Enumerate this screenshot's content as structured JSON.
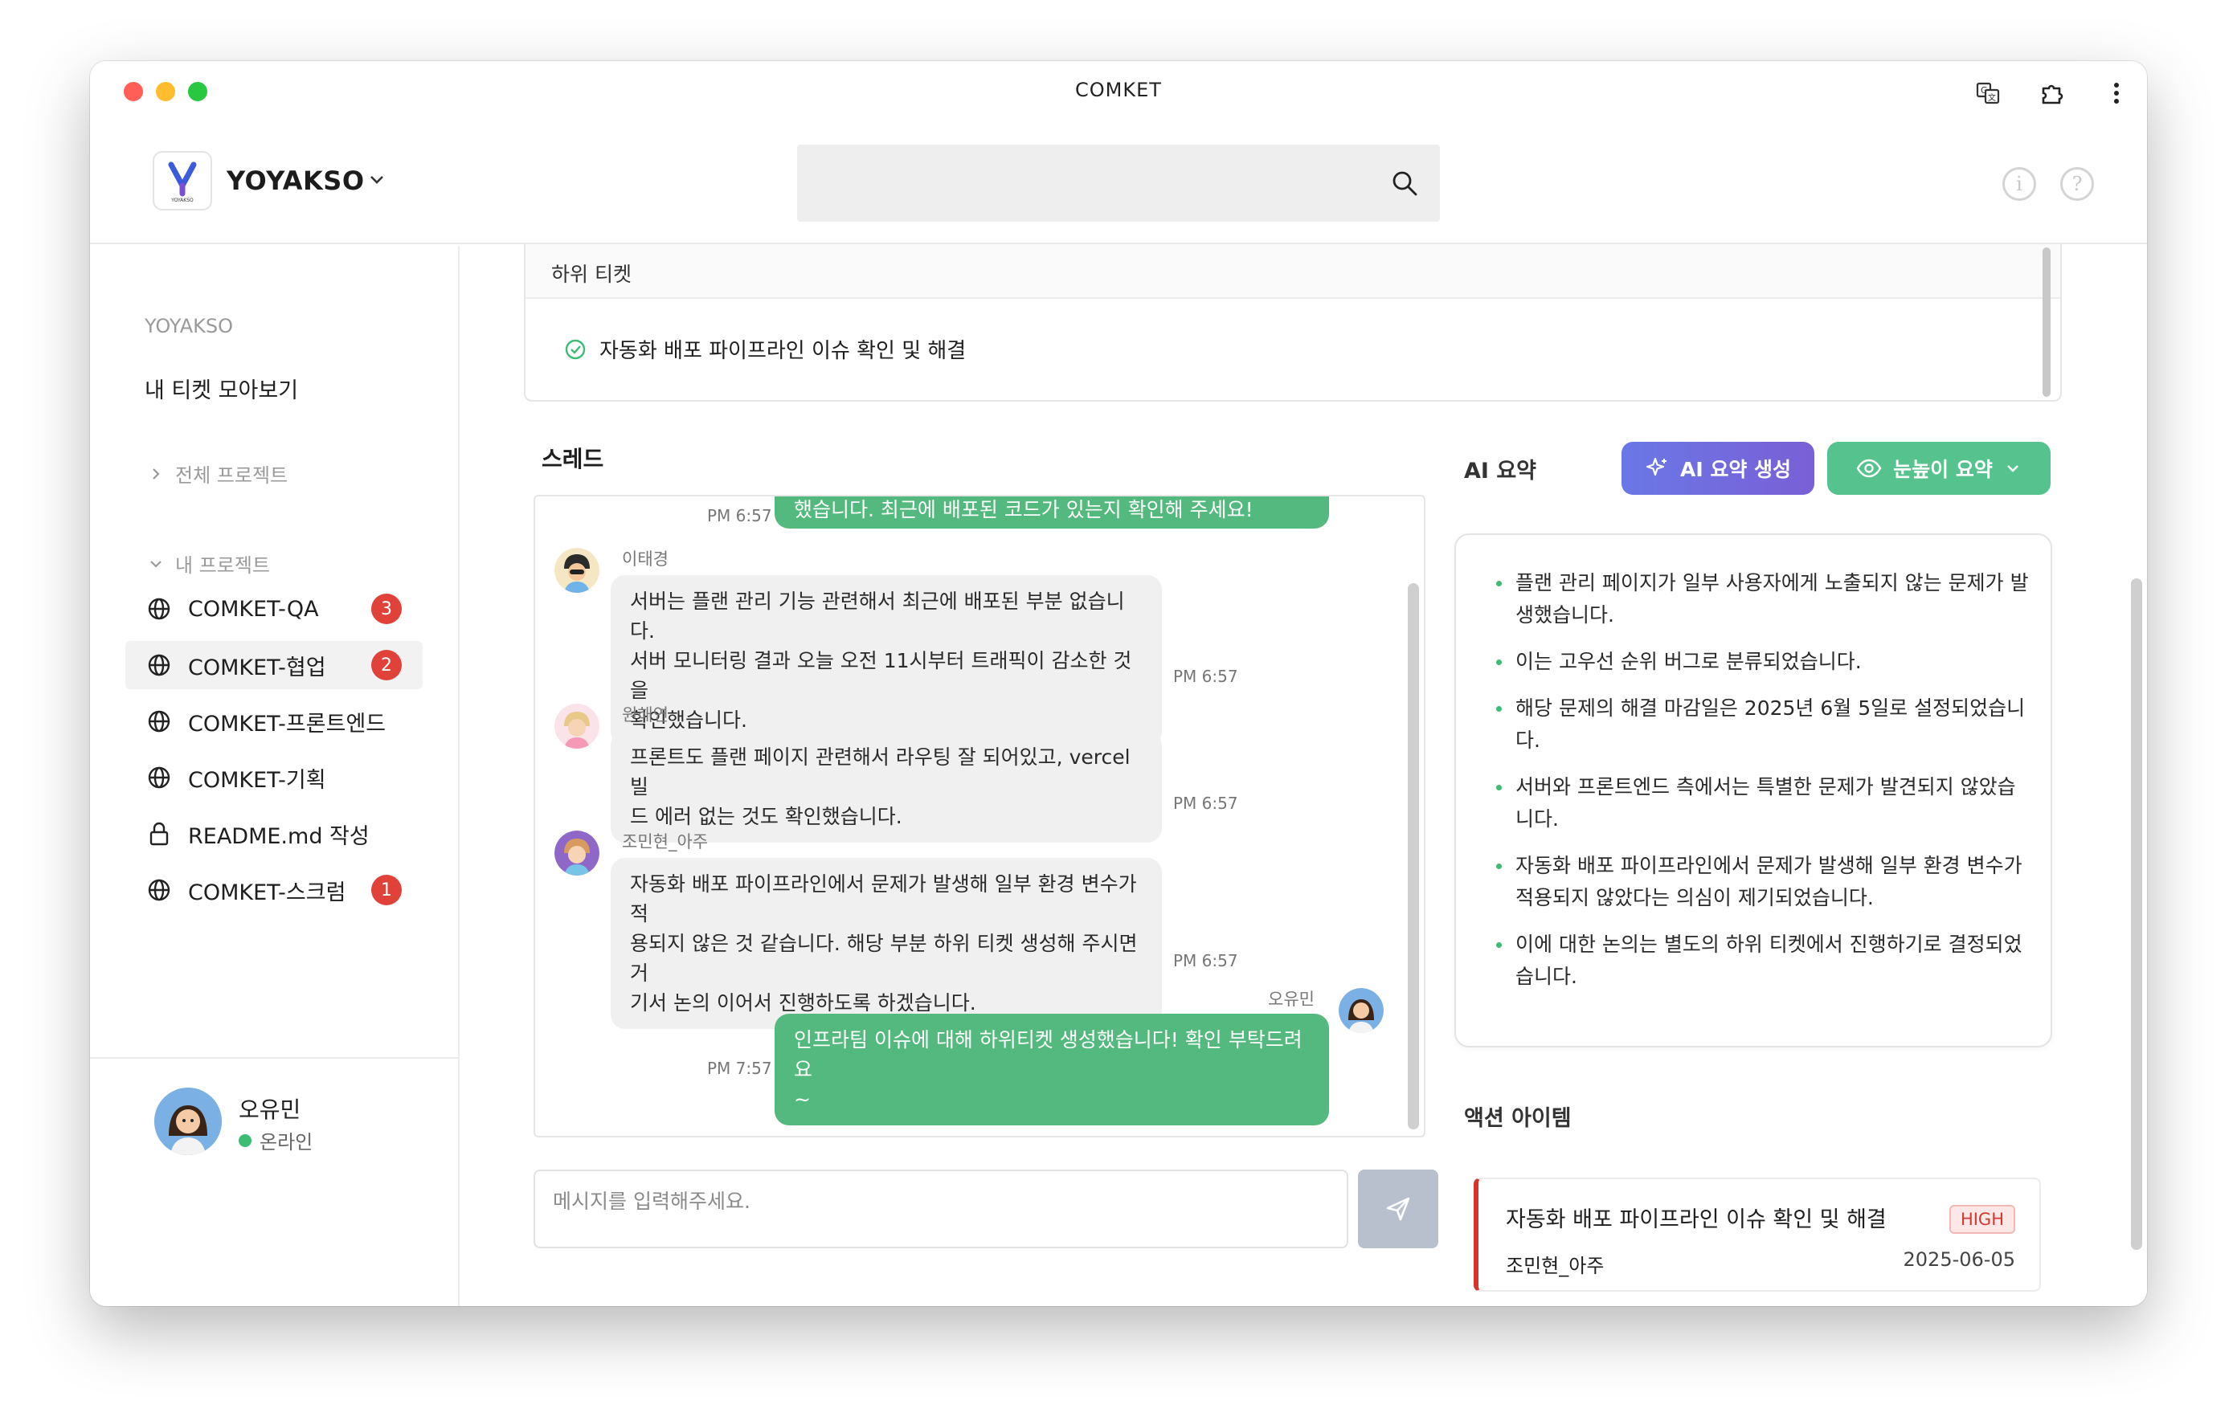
{
  "window": {
    "title": "COMKET"
  },
  "header": {
    "workspace_name": "YOYAKSO",
    "logo_text": "YOYAKSO",
    "search_placeholder": ""
  },
  "sidebar": {
    "section_label": "YOYAKSO",
    "my_tickets": "내 티켓 모아보기",
    "all_projects": "전체 프로젝트",
    "my_projects": "내 프로젝트",
    "projects": [
      {
        "name": "COMKET-QA",
        "icon": "globe-icon",
        "badge": "3",
        "active": false
      },
      {
        "name": "COMKET-협업",
        "icon": "globe-icon",
        "badge": "2",
        "active": true
      },
      {
        "name": "COMKET-프론트엔드",
        "icon": "globe-icon",
        "badge": "",
        "active": false
      },
      {
        "name": "COMKET-기획",
        "icon": "globe-icon",
        "badge": "",
        "active": false
      },
      {
        "name": "README.md 작성",
        "icon": "lock-icon",
        "badge": "",
        "active": false
      },
      {
        "name": "COMKET-스크럼",
        "icon": "globe-icon",
        "badge": "1",
        "active": false
      }
    ],
    "user": {
      "name": "오유민",
      "status": "온라인"
    }
  },
  "subtickets": {
    "title": "하위 티켓",
    "items": [
      {
        "title": "자동화 배포 파이프라인 이슈 확인 및 해결"
      }
    ]
  },
  "thread": {
    "label": "스레드",
    "messages": [
      {
        "sender": "",
        "time": "PM 6:57",
        "mine": true,
        "text": "했습니다. 최근에 배포된 코드가 있는지 확인해 주세요!"
      },
      {
        "sender": "이태경",
        "time": "PM 6:57",
        "mine": false,
        "text": "서버는 플랜 관리 기능 관련해서 최근에 배포된 부분 없습니다.\n서버 모니터링 결과 오늘 오전 11시부터 트래픽이 감소한 것을\n확인했습니다."
      },
      {
        "sender": "원해연",
        "time": "PM 6:57",
        "mine": false,
        "text": "프론트도 플랜 페이지 관련해서 라우팅 잘 되어있고, vercel 빌\n드 에러 없는 것도 확인했습니다."
      },
      {
        "sender": "조민현_아주",
        "time": "PM 6:57",
        "mine": false,
        "text": "자동화 배포 파이프라인에서 문제가 발생해 일부 환경 변수가 적\n용되지 않은 것 같습니다. 해당 부분 하위 티켓 생성해 주시면 거\n기서 논의 이어서 진행하도록 하겠습니다."
      },
      {
        "sender": "오유민",
        "time": "PM 7:57",
        "mine": true,
        "text": "인프라팀 이슈에 대해 하위티켓 생성했습니다! 확인 부탁드려요\n~"
      }
    ],
    "composer_placeholder": "메시지를 입력해주세요."
  },
  "ai": {
    "label": "AI 요약",
    "generate_button": "AI 요약 생성",
    "level_button": "눈높이 요약",
    "summary": [
      "플랜 관리 페이지가 일부 사용자에게 노출되지 않는 문제가 발생했습니다.",
      "이는 고우선 순위 버그로 분류되었습니다.",
      "해당 문제의 해결 마감일은 2025년 6월 5일로 설정되었습니다.",
      "서버와 프론트엔드 측에서는 특별한 문제가 발견되지 않았습니다.",
      "자동화 배포 파이프라인에서 문제가 발생해 일부 환경 변수가 적용되지 않았다는 의심이 제기되었습니다.",
      "이에 대한 논의는 별도의 하위 티켓에서 진행하기로 결정되었습니다."
    ],
    "actions_label": "액션 아이템",
    "action_items": [
      {
        "title": "자동화 배포 파이프라인 이슈 확인 및 해결",
        "priority": "HIGH",
        "assignee": "조민현_아주",
        "due": "2025-06-05"
      }
    ]
  },
  "colors": {
    "accent_green": "#54b97e",
    "badge_red": "#e0423a",
    "ai_purple": "#6a78e6",
    "priority_red": "#d9342b"
  }
}
